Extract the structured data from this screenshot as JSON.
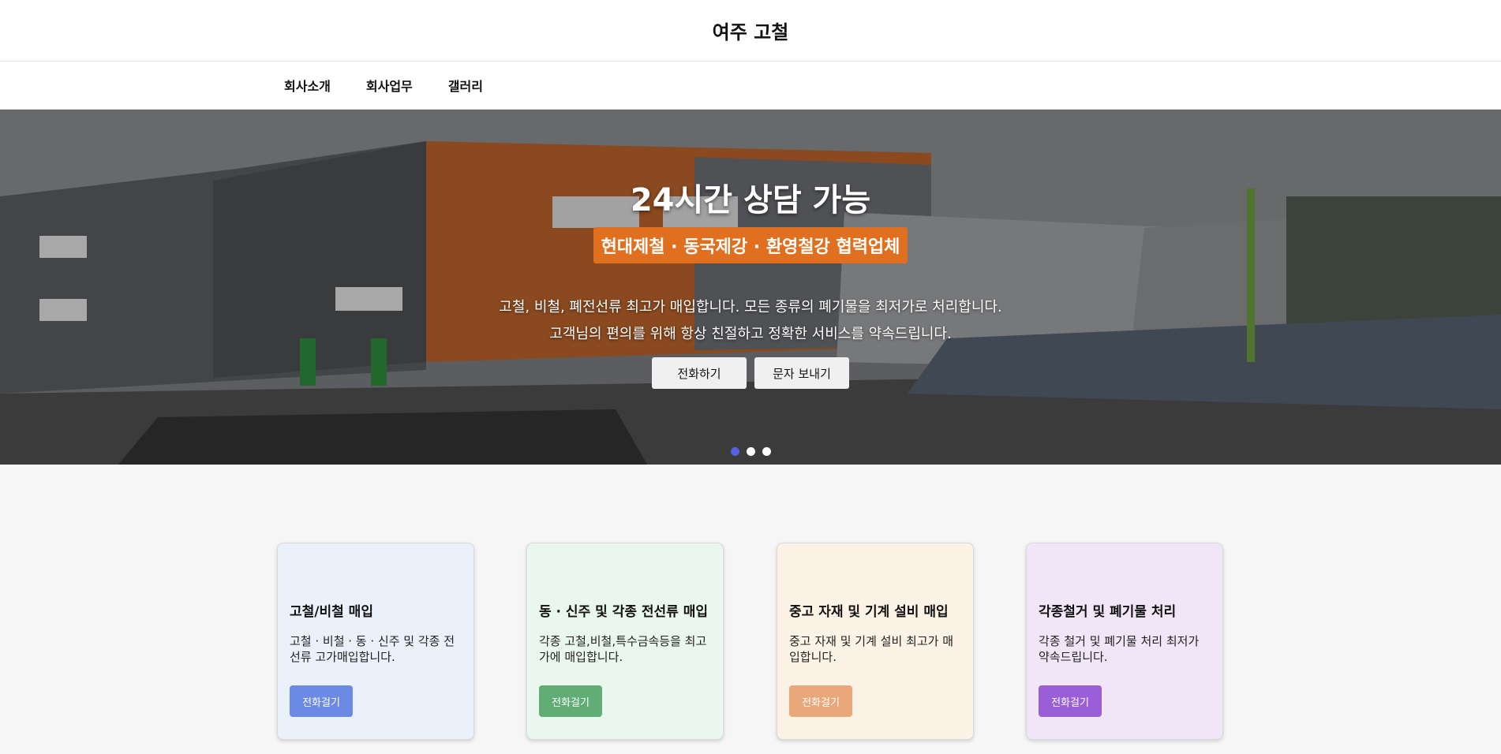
{
  "header": {
    "title": "여주 고철"
  },
  "nav": {
    "items": [
      "회사소개",
      "회사업무",
      "갤러리"
    ]
  },
  "hero": {
    "title": "24시간 상담 가능",
    "badge": "현대제철 · 동국제강 · 환영철강 협력업체",
    "line1": "고철, 비철, 폐전선류 최고가 매입합니다. 모든 종류의 폐기물을 최저가로 처리합니다.",
    "line2": "고객님의 편의를 위해 항상 친절하고 정확한 서비스를 약속드립니다.",
    "call_label": "전화하기",
    "sms_label": "문자 보내기",
    "active_slide": 1,
    "slide_count": 3,
    "accent": "#e0701f"
  },
  "services": [
    {
      "title": "고철/비철 매입",
      "desc": "고철 · 비철 · 동 · 신주 및 각종 전선류 고가매입합니다.",
      "button": "전화걸기",
      "bg": "#ebf1fb",
      "btn": "#6c8ae4"
    },
    {
      "title": "동 · 신주 및 각종 전선류 매입",
      "desc": "각종 고철,비철,특수금속등을 최고가에 매입합니다.",
      "button": "전화걸기",
      "bg": "#eaf7ee",
      "btn": "#60ad76"
    },
    {
      "title": "중고 자재 및 기계 설비 매입",
      "desc": "중고 자재 및 기계 설비 최고가 매입합니다.",
      "button": "전화걸기",
      "bg": "#fcf3e6",
      "btn": "#e8a87a"
    },
    {
      "title": "각종철거 및 폐기물 처리",
      "desc": "각종 철거 및 폐기물 처리 최저가 약속드립니다.",
      "button": "전화걸기",
      "bg": "#f1e6f8",
      "btn": "#9a5fd6"
    }
  ]
}
